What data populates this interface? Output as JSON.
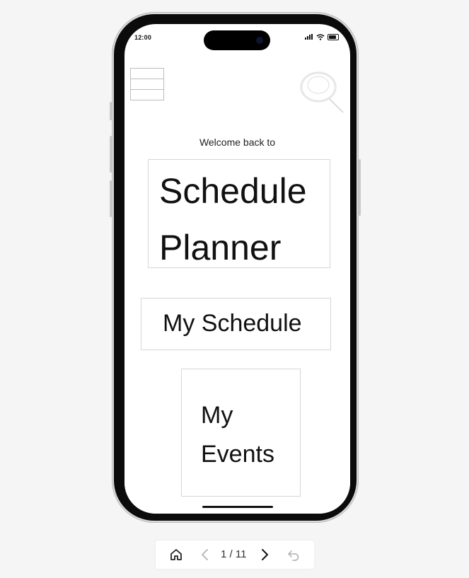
{
  "status_bar": {
    "time": "12:00"
  },
  "app": {
    "welcome": "Welcome back to",
    "title": "Schedule Planner",
    "title_line1": "Schedule",
    "title_line2": "Planner",
    "my_schedule": "My Schedule",
    "my_events_line1": "My",
    "my_events_line2": "Events"
  },
  "pager": {
    "current": 1,
    "total": 11,
    "label": "1 / 11"
  },
  "icons": [
    "menu-icon",
    "search-icon",
    "home-icon",
    "chevron-left-icon",
    "chevron-right-icon",
    "undo-icon"
  ],
  "colors": {
    "page_bg": "#f5f5f5",
    "screen_bg": "#ffffff",
    "frame": "#0b0b0b",
    "box_border": "#d6d6d6"
  }
}
